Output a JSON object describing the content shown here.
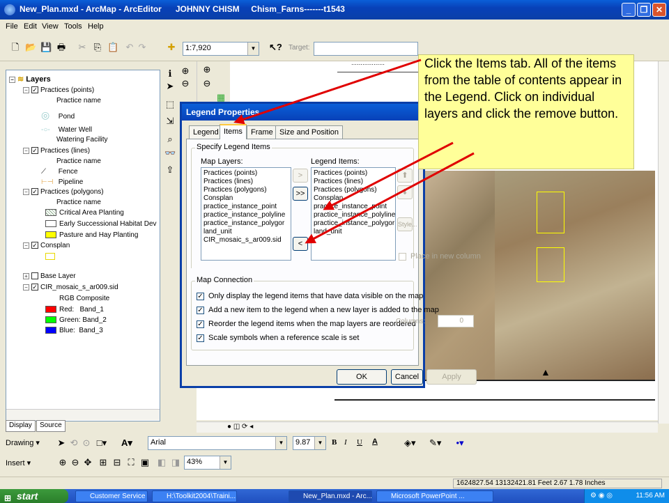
{
  "window": {
    "title": "New_Plan.mxd - ArcMap - ArcEditor      JOHNNY CHISM     Chism_Farns-------t1543"
  },
  "menu": [
    "File",
    "Edit",
    "View",
    "Tools",
    "Help"
  ],
  "toolbar": {
    "scale": "1:7,920",
    "target_label": "Target:"
  },
  "toc": {
    "root": "Layers",
    "layers": [
      {
        "name": "Practices (points)",
        "sub": "Practice name",
        "items": [
          "Pond",
          "Water Well",
          "Watering Facility"
        ]
      },
      {
        "name": "Practices (lines)",
        "sub": "Practice name",
        "items": [
          "Fence",
          "Pipeline"
        ]
      },
      {
        "name": "Practices (polygons)",
        "sub": "Practice name",
        "items": [
          "Critical Area Planting",
          "Early Successional Habitat Dev",
          "Pasture and Hay Planting"
        ]
      },
      {
        "name": "Consplan"
      },
      {
        "name": "Base Layer"
      },
      {
        "name": "CIR_mosaic_s_ar009.sid",
        "sub": "RGB Composite",
        "items": [
          "Red:   Band_1",
          "Green: Band_2",
          "Blue:  Band_3"
        ]
      }
    ],
    "tabs": [
      "Display",
      "Source"
    ],
    "colors": {
      "red": "#ff0000",
      "green": "#00ff00",
      "blue": "#0000ff",
      "yellow": "#ffff00"
    }
  },
  "dialog": {
    "title": "Legend Properties",
    "tabs": [
      "Legend",
      "Items",
      "Frame",
      "Size and Position"
    ],
    "active_tab": "Items",
    "group_specify": "Specify Legend Items",
    "map_layers_label": "Map Layers:",
    "legend_items_label": "Legend Items:",
    "map_layers": [
      "Practices (points)",
      "Practices (lines)",
      "Practices (polygons)",
      "Consplan",
      "practice_instance_point",
      "practice_instance_polyline",
      "practice_instance_polygor",
      "land_unit",
      "CIR_mosaic_s_ar009.sid"
    ],
    "legend_items": [
      "Practices (points)",
      "Practices (lines)",
      "Practices (polygons)",
      "Consplan",
      "practice_instance_point",
      "practice_instance_polyline",
      "practice_instance_polygor",
      "land_unit"
    ],
    "add_btn": ">",
    "add_all_btn": ">>",
    "remove_btn": "<",
    "style_btn": "Style...",
    "new_column_label": "Place in new column",
    "columns_label": "Columns:",
    "columns_value": "0",
    "group_connection": "Map Connection",
    "options": [
      "Only display the legend items that have data visible on the map",
      "Add a new item to the legend when a new layer is added to the map",
      "Reorder the legend items when the map layers are reordered",
      "Scale symbols when a reference scale is set"
    ],
    "ok": "OK",
    "cancel": "Cancel",
    "apply": "Apply"
  },
  "callout": {
    "text": "Click the Items tab. All of the items from the table of contents appear in the Legend. Click on individual layers and click the remove button."
  },
  "drawing_toolbar": {
    "drawing_label": "Drawing",
    "font": "Arial",
    "font_size": "9.87",
    "bold": "B",
    "italic": "I",
    "underline": "U",
    "font_color": "A"
  },
  "insert_toolbar": {
    "insert_label": "Insert",
    "zoom": "43%"
  },
  "status": {
    "coords": "1624827.54  13132421.81 Feet  2.67  1.78 Inches"
  },
  "taskbar": {
    "start": "start",
    "tasks": [
      "Customer Service To...",
      "H:\\Toolkit2004\\Traini...",
      "New_Plan.mxd - Arc...",
      "Microsoft PowerPoint ..."
    ],
    "clock": "11:56 AM"
  }
}
